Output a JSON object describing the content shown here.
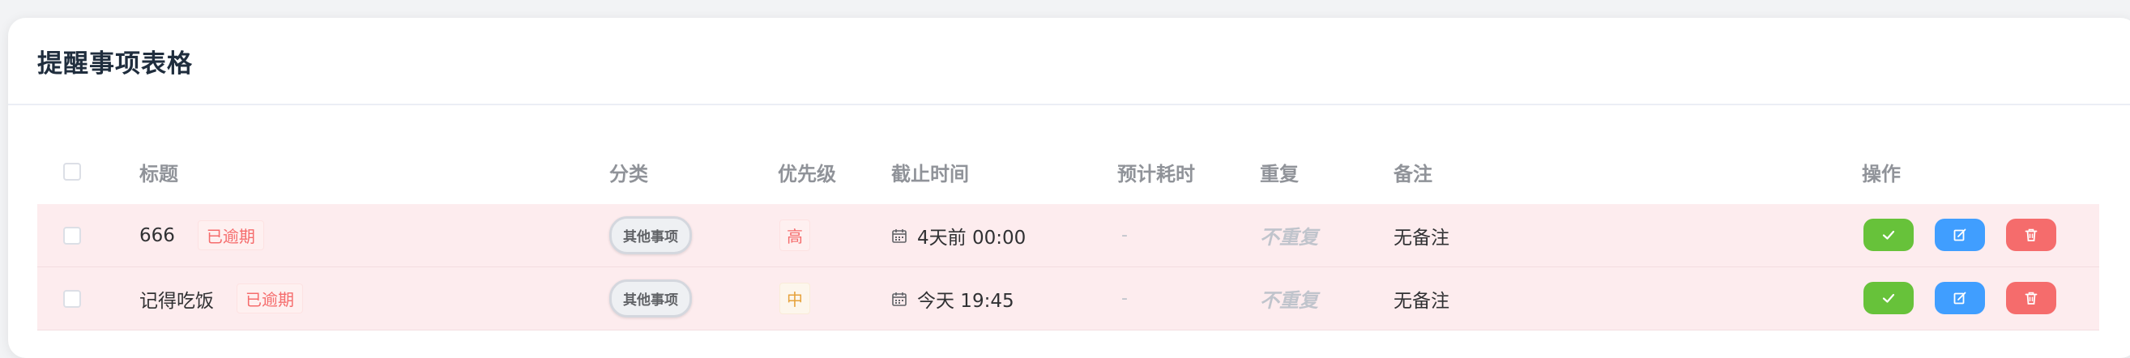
{
  "card": {
    "title": "提醒事项表格"
  },
  "table": {
    "headers": {
      "title": "标题",
      "category": "分类",
      "priority": "优先级",
      "deadline": "截止时间",
      "estimate": "预计耗时",
      "repeat": "重复",
      "notes": "备注",
      "actions": "操作"
    },
    "rows": [
      {
        "title": "666",
        "status_tag": "已逾期",
        "category": "其他事项",
        "priority": "高",
        "priority_color": "#f56c6c",
        "deadline": "4天前 00:00",
        "estimate": "-",
        "repeat": "不重复",
        "notes": "无备注"
      },
      {
        "title": "记得吃饭",
        "status_tag": "已逾期",
        "category": "其他事项",
        "priority": "中",
        "priority_color": "#e6a23c",
        "deadline": "今天 19:45",
        "estimate": "-",
        "repeat": "不重复",
        "notes": "无备注"
      }
    ]
  },
  "icons": {
    "deadline": "calendar-icon",
    "complete": "check-icon",
    "edit": "edit-icon",
    "delete": "trash-icon"
  },
  "colors": {
    "overdue_row_bg": "#fdecee",
    "complete_button": "#67c23a",
    "edit_button": "#409eff",
    "delete_button": "#f56c6c"
  }
}
